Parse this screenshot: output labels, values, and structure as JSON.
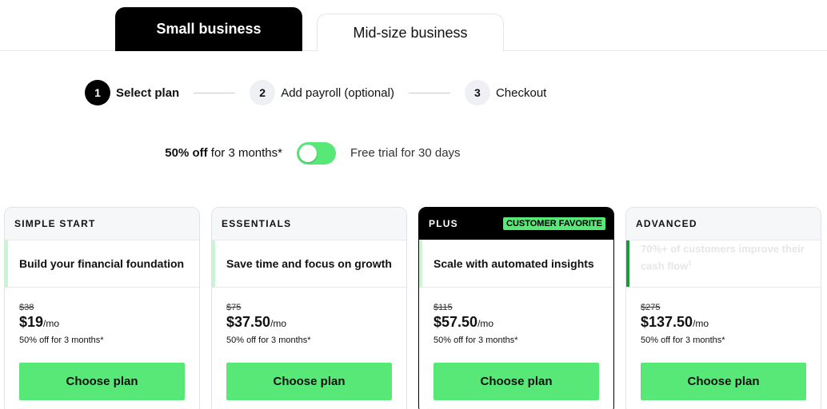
{
  "tabs": [
    {
      "label": "Small business",
      "active": true
    },
    {
      "label": "Mid-size business",
      "active": false
    }
  ],
  "stepper": [
    {
      "number": "1",
      "label": "Select plan"
    },
    {
      "number": "2",
      "label": "Add payroll (optional)"
    },
    {
      "number": "3",
      "label": "Checkout"
    }
  ],
  "promo": {
    "discount_bold": "50% off",
    "discount_rest": " for 3 months*",
    "toggle_on": true,
    "trial_label": "Free trial for 30 days"
  },
  "plans": [
    {
      "name": "SIMPLE START",
      "tagline": "Build your financial foundation",
      "old_price": "$38",
      "price": "$19",
      "per": "/mo",
      "discount": "50% off for 3 months*",
      "cta": "Choose plan"
    },
    {
      "name": "ESSENTIALS",
      "tagline": "Save time and focus on growth",
      "old_price": "$75",
      "price": "$37.50",
      "per": "/mo",
      "discount": "50% off for 3 months*",
      "cta": "Choose plan"
    },
    {
      "name": "PLUS",
      "badge": "CUSTOMER FAVORITE",
      "tagline": "Scale with automated insights",
      "old_price": "$115",
      "price": "$57.50",
      "per": "/mo",
      "discount": "50% off for 3 months*",
      "cta": "Choose plan"
    },
    {
      "name": "ADVANCED",
      "tagline": "70%+ of customers improve their cash flow",
      "tagline_sup": "1",
      "old_price": "$275",
      "price": "$137.50",
      "per": "/mo",
      "discount": "50% off for 3 months*",
      "cta": "Choose plan"
    }
  ],
  "colors": {
    "accent_green": "#58e878",
    "dark": "#000000"
  }
}
